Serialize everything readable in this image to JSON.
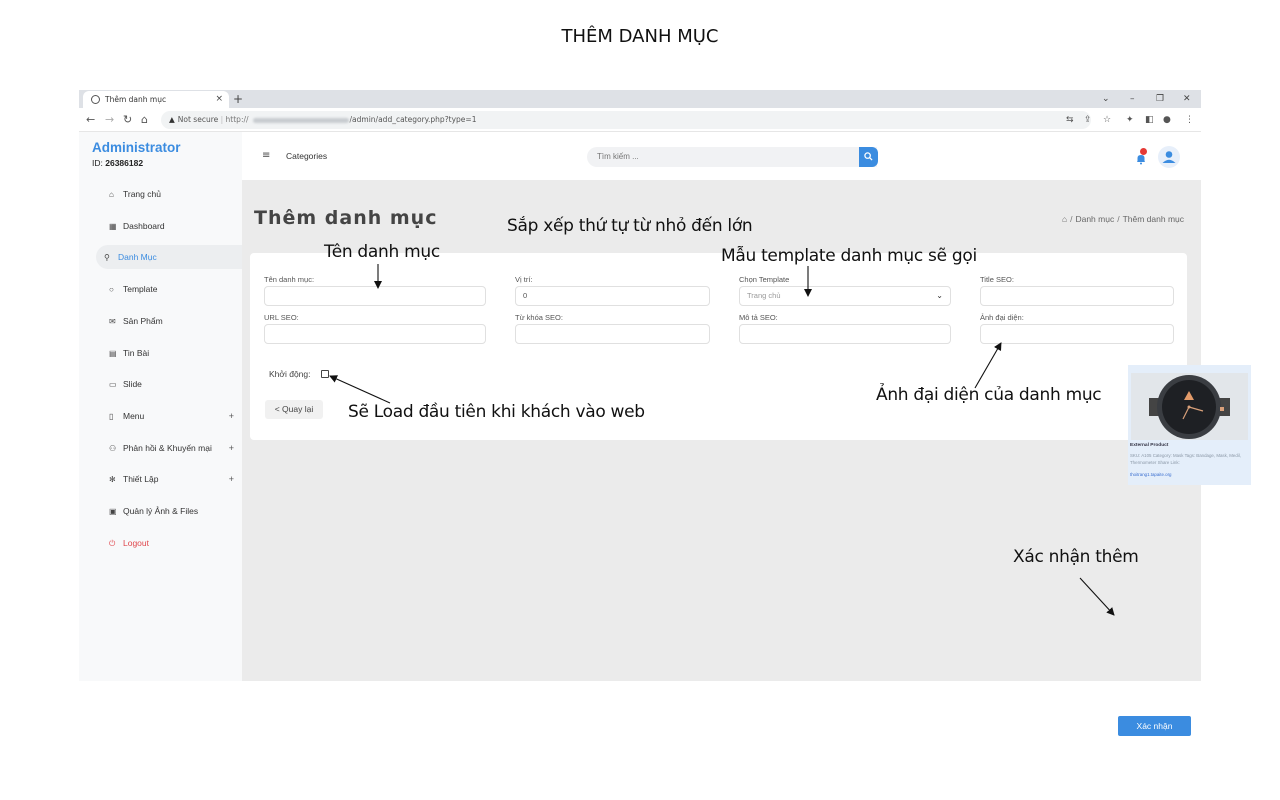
{
  "doc_title": "THÊM DANH MỤC",
  "browser": {
    "tab_title": "Thêm danh mục",
    "tab_close": "×",
    "new_tab": "+",
    "url_warning": "Not secure",
    "url_prefix": "http://",
    "url_path": "/admin/add_category.php?type=1",
    "window_controls": {
      "dropdown": "⌄",
      "minimize": "–",
      "restore": "❐",
      "close": "✕"
    }
  },
  "sidebar": {
    "brand": "Administrator",
    "id_label": "ID: ",
    "id_value": "26386182",
    "items": [
      {
        "label": "Trang chủ",
        "icon": "home-icon",
        "glyph": "⌂"
      },
      {
        "label": "Dashboard",
        "icon": "grid-icon",
        "glyph": "▦"
      },
      {
        "label": "Danh Mục",
        "icon": "link-icon",
        "glyph": "⚲",
        "active": true
      },
      {
        "label": "Template",
        "icon": "circle-icon",
        "glyph": "○"
      },
      {
        "label": "Sản Phẩm",
        "icon": "mail-icon",
        "glyph": "✉"
      },
      {
        "label": "Tin Bài",
        "icon": "news-icon",
        "glyph": "▤"
      },
      {
        "label": "Slide",
        "icon": "presentation-icon",
        "glyph": "▭"
      },
      {
        "label": "Menu",
        "icon": "menu-icon",
        "glyph": "▯",
        "plus": "+"
      },
      {
        "label": "Phản hồi & Khuyến mại",
        "icon": "user-icon",
        "glyph": "⚇",
        "plus": "+"
      },
      {
        "label": "Thiết Lập",
        "icon": "gear-icon",
        "glyph": "✻",
        "plus": "+"
      },
      {
        "label": "Quản lý Ảnh & Files",
        "icon": "image-icon",
        "glyph": "▣"
      },
      {
        "label": "Logout",
        "icon": "power-icon",
        "glyph": "⏻",
        "logout": true
      }
    ]
  },
  "topbar": {
    "menu_glyph": "≡",
    "title": "Categories",
    "search_placeholder": "Tìm kiếm ..."
  },
  "page": {
    "title": "Thêm danh mục",
    "breadcrumb_sep": "/",
    "breadcrumb": [
      "Danh mục",
      "Thêm danh mục"
    ]
  },
  "form": {
    "name_label": "Tên danh mục:",
    "name_value": "",
    "position_label": "Vị trí:",
    "position_value": "0",
    "template_label": "Chọn Template",
    "template_value": "Trang chủ",
    "template_chevron": "⌄",
    "title_seo_label": "Title SEO:",
    "title_seo_value": "",
    "url_seo_label": "URL SEO:",
    "url_seo_value": "",
    "keywords_seo_label": "Từ khóa SEO:",
    "keywords_seo_value": "",
    "desc_seo_label": "Mô tả SEO:",
    "desc_seo_value": "",
    "image_label": "Ảnh đại diện:",
    "image_value": "",
    "startup_label": "Khởi động:",
    "startup_checked": false,
    "back_label": "< Quay lại",
    "confirm_label": "Xác nhận"
  },
  "popup": {
    "name": "External Product",
    "meta": "SKU: A105 Category: Mask Tags: Bandage, Mask, Medil, Thermometer Share Link:",
    "link": "thoitrang1.tapaite.org"
  },
  "annotations": {
    "order": "Sắp xếp thứ tự từ nhỏ đến lớn",
    "name": "Tên danh mục",
    "template": "Mẫu template danh mục sẽ gọi",
    "startup": "Sẽ Load đầu tiên khi khách vào web",
    "image": "Ảnh đại diện của danh mục",
    "confirm": "Xác nhận thêm"
  },
  "colors": {
    "accent": "#3b8ce0",
    "logout": "#e0474c",
    "content_bg": "#ebebeb",
    "sidebar_bg": "#f8f9fa"
  }
}
